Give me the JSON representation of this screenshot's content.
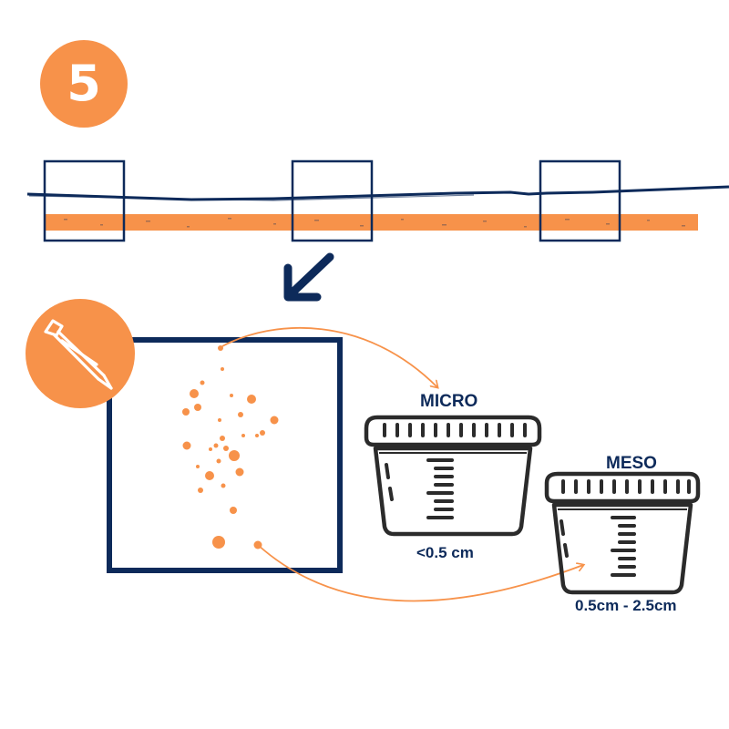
{
  "step": {
    "number": "5"
  },
  "containers": {
    "micro": {
      "label": "MICRO",
      "size": "<0.5 cm"
    },
    "meso": {
      "label": "MESO",
      "size": "0.5cm - 2.5cm"
    }
  },
  "icons": {
    "step": "step-number-badge",
    "arrow": "arrow-down-left-icon",
    "tool": "tweezers-icon",
    "container": "specimen-cup-icon"
  },
  "colors": {
    "orange": "#f7924a",
    "navy": "#0d2a5a",
    "dark": "#2b2b2b"
  }
}
